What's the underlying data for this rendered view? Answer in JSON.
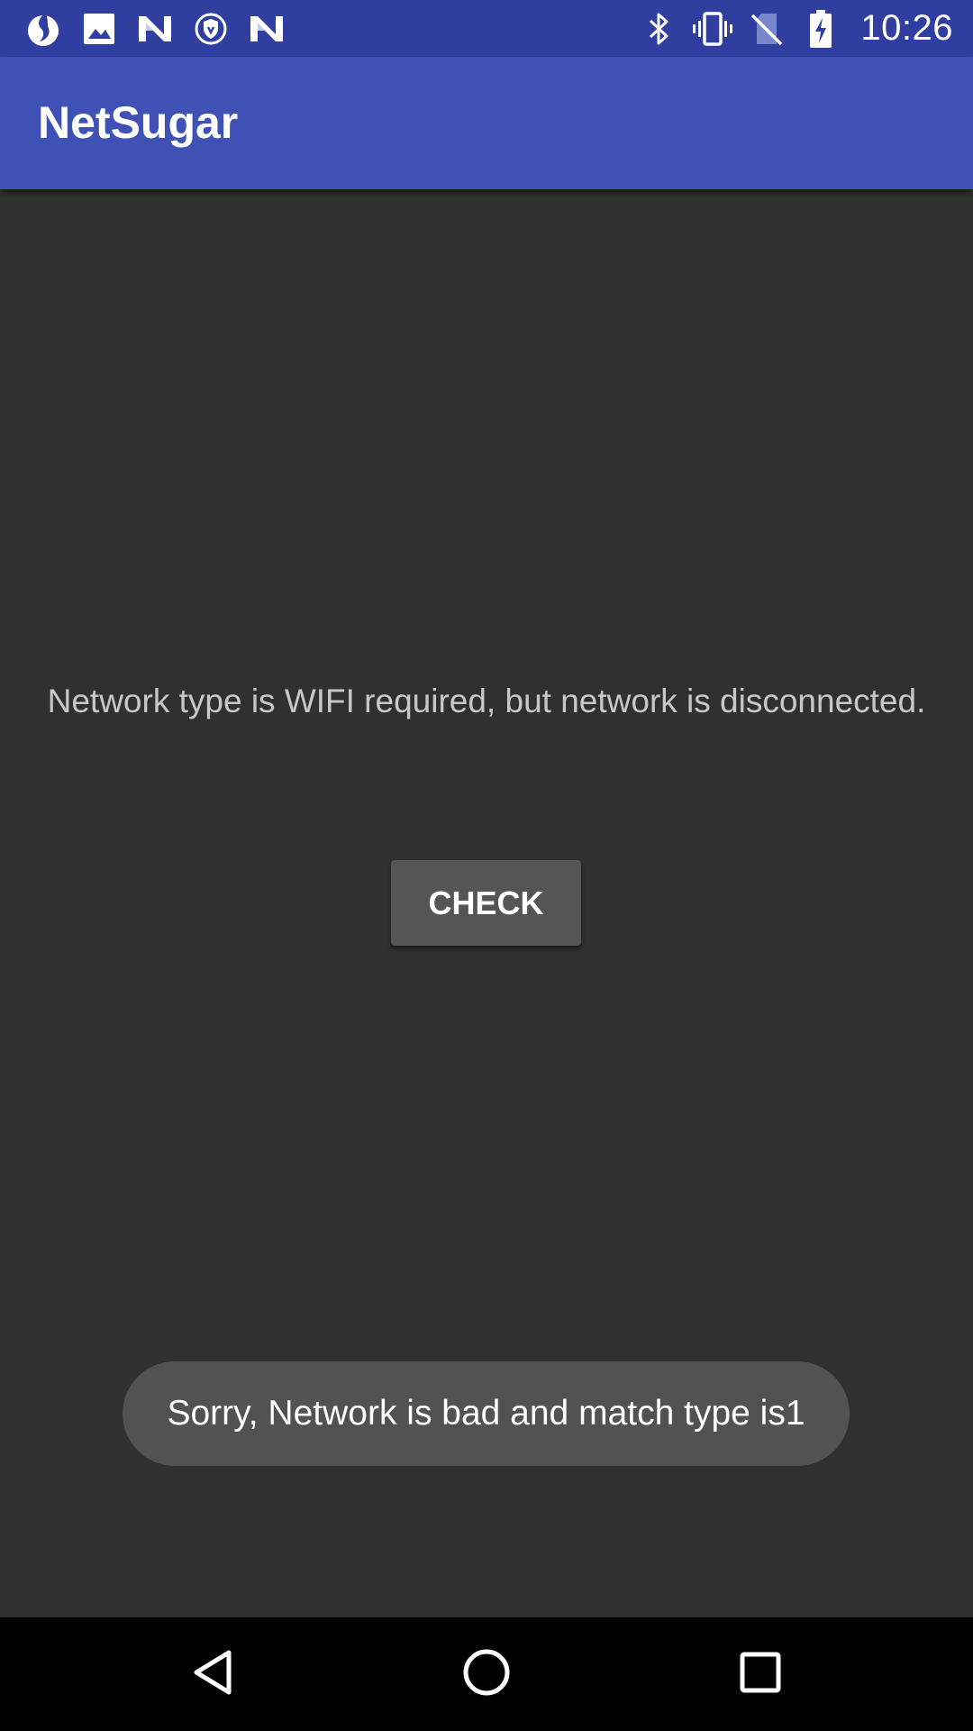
{
  "status_bar": {
    "time": "10:26",
    "left_icons": [
      "app-notification-icon",
      "image-icon",
      "n-notification-icon",
      "shield-icon",
      "n-notification-icon"
    ],
    "right_icons": [
      "bluetooth-icon",
      "vibrate-icon",
      "no-sim-icon",
      "battery-charging-icon"
    ]
  },
  "app_bar": {
    "title": "NetSugar"
  },
  "main": {
    "message": "Network type is WIFI required, but network is disconnected.",
    "check_button_label": "CHECK"
  },
  "toast": {
    "text": "Sorry, Network is bad and match type is1"
  },
  "nav_bar": {
    "buttons": [
      "back-icon",
      "home-icon",
      "recents-icon"
    ]
  },
  "colors": {
    "status_bar": "#303f9f",
    "app_bar": "#3f51b5",
    "background": "#303030",
    "button": "#555555",
    "toast": "#525252"
  }
}
